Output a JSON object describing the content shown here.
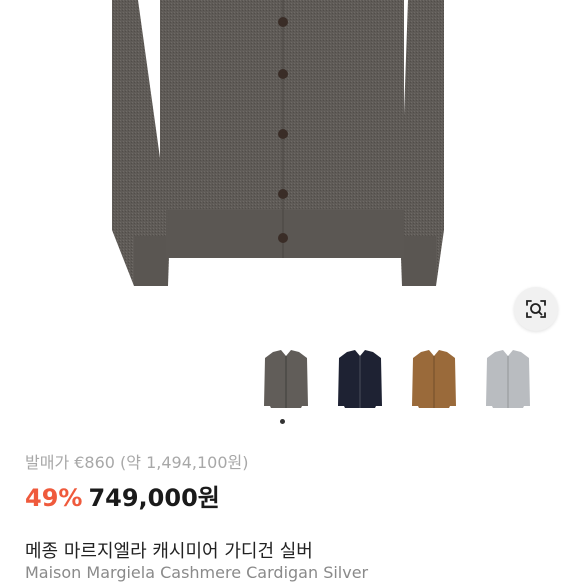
{
  "product": {
    "images": [
      {
        "color_name": "gray",
        "color": "#615d59"
      },
      {
        "color_name": "navy",
        "color": "#1e2233"
      },
      {
        "color_name": "brown",
        "color": "#9a6a3a"
      },
      {
        "color_name": "silver",
        "color": "#b9bcc0"
      }
    ],
    "selected_index": 0,
    "retail_label": "발매가 €860 (약 1,494,100원)",
    "discount": "49%",
    "price": "749,000원",
    "title": "메종 마르지엘라 캐시미어 가디건 실버",
    "subtitle": "Maison Margiela Cashmere Cardigan Silver"
  },
  "icons": {
    "visual_search": "lens-search-icon"
  },
  "colors": {
    "discount": "#ef5a3c",
    "text": "#1a1a1a",
    "muted": "#a8a8a8"
  }
}
